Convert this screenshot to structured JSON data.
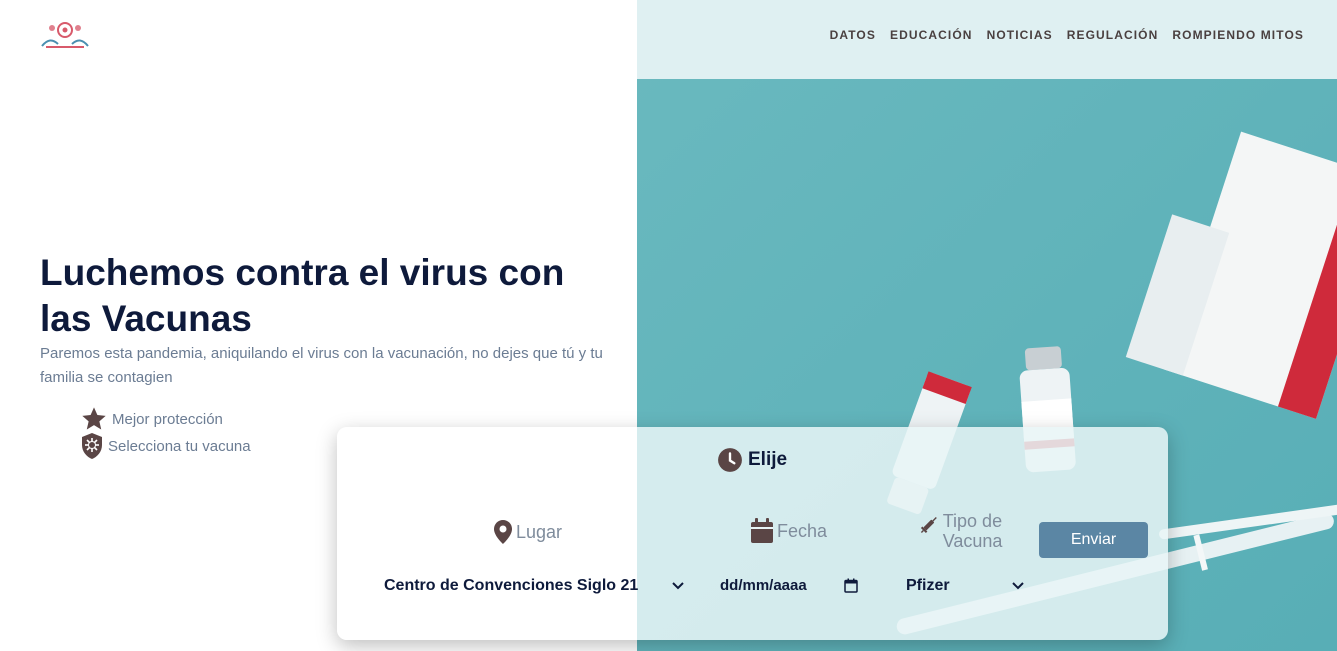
{
  "nav": {
    "items": [
      "DATOS",
      "EDUCACIÓN",
      "NOTICIAS",
      "REGULACIÓN",
      "ROMPIENDO MITOS"
    ]
  },
  "hero": {
    "title": "Luchemos contra el virus con las Vacunas",
    "subtitle": "Paremos esta pandemia, aniquilando el virus con la vacunación, no dejes que tú y tu familia se contagien",
    "features": [
      {
        "icon": "star-icon",
        "label": "Mejor protección"
      },
      {
        "icon": "shield-virus-icon",
        "label": "Selecciona tu vacuna"
      }
    ]
  },
  "booking": {
    "title": "Elije",
    "lugar_label": "Lugar",
    "fecha_label": "Fecha",
    "tipo_label": "Tipo de Vacuna",
    "lugar_value": "Centro de Convenciones Siglo 21",
    "fecha_placeholder": "dd/mm/aaaa",
    "tipo_value": "Pfizer",
    "submit_label": "Enviar"
  },
  "colors": {
    "navy": "#0e1a3b",
    "muted_text": "#6b7c93",
    "icon_brown": "#5a4545",
    "teal_bg": "#63b4bb",
    "header_tint": "#dff0f2",
    "button": "#5b86a4"
  }
}
